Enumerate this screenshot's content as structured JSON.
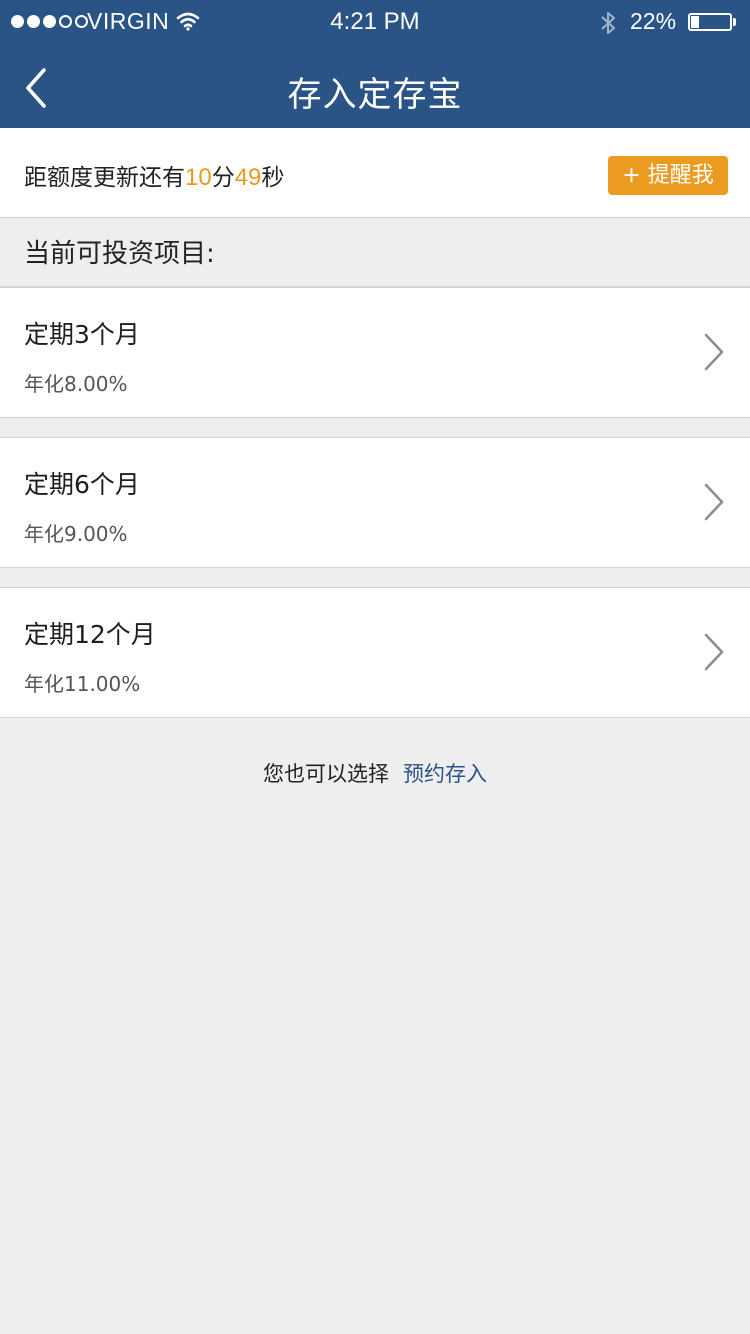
{
  "status_bar": {
    "carrier": "VIRGIN",
    "time": "4:21 PM",
    "battery_percent": "22%",
    "battery_level": 0.22,
    "signal_bars_filled": 3,
    "signal_bars_total": 5,
    "icons": [
      "wifi-icon",
      "bluetooth-icon",
      "battery-icon"
    ]
  },
  "nav": {
    "title": "存入定存宝",
    "back_icon": "chevron-left-icon"
  },
  "countdown": {
    "prefix": "距额度更新还有",
    "minutes": "10",
    "minute_unit": "分",
    "seconds": "49",
    "second_unit": "秒",
    "remind_label": "+ 提醒我"
  },
  "section": {
    "title": "当前可投资项目:"
  },
  "products": [
    {
      "name": "定期3个月",
      "rate": "年化8.00%"
    },
    {
      "name": "定期6个月",
      "rate": "年化9.00%"
    },
    {
      "name": "定期12个月",
      "rate": "年化11.00%"
    }
  ],
  "footer": {
    "text": "您也可以选择",
    "link": "预约存入"
  },
  "colors": {
    "nav_bg": "#2b5486",
    "accent_orange": "#ec9b21",
    "highlight_number": "#e89a1e",
    "link": "#2b5486",
    "page_bg": "#eeeeee"
  }
}
